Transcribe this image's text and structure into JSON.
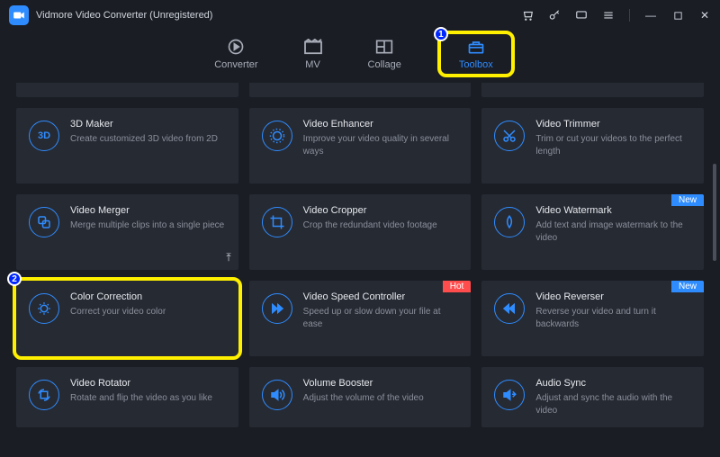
{
  "window": {
    "title": "Vidmore Video Converter (Unregistered)"
  },
  "tabs": [
    {
      "label": "Converter"
    },
    {
      "label": "MV"
    },
    {
      "label": "Collage"
    },
    {
      "label": "Toolbox"
    }
  ],
  "callouts": {
    "c1": "1",
    "c2": "2"
  },
  "cards": {
    "maker3d": {
      "title": "3D Maker",
      "desc": "Create customized 3D video from 2D"
    },
    "enhancer": {
      "title": "Video Enhancer",
      "desc": "Improve your video quality in several ways"
    },
    "trimmer": {
      "title": "Video Trimmer",
      "desc": "Trim or cut your videos to the perfect length"
    },
    "merger": {
      "title": "Video Merger",
      "desc": "Merge multiple clips into a single piece"
    },
    "cropper": {
      "title": "Video Cropper",
      "desc": "Crop the redundant video footage"
    },
    "watermark": {
      "title": "Video Watermark",
      "desc": "Add text and image watermark to the video",
      "badge": "New"
    },
    "color": {
      "title": "Color Correction",
      "desc": "Correct your video color"
    },
    "speed": {
      "title": "Video Speed Controller",
      "desc": "Speed up or slow down your file at ease",
      "badge": "Hot"
    },
    "reverser": {
      "title": "Video Reverser",
      "desc": "Reverse your video and turn it backwards",
      "badge": "New"
    },
    "rotator": {
      "title": "Video Rotator",
      "desc": "Rotate and flip the video as you like"
    },
    "volume": {
      "title": "Volume Booster",
      "desc": "Adjust the volume of the video"
    },
    "audiosync": {
      "title": "Audio Sync",
      "desc": "Adjust and sync the audio with the video"
    }
  }
}
